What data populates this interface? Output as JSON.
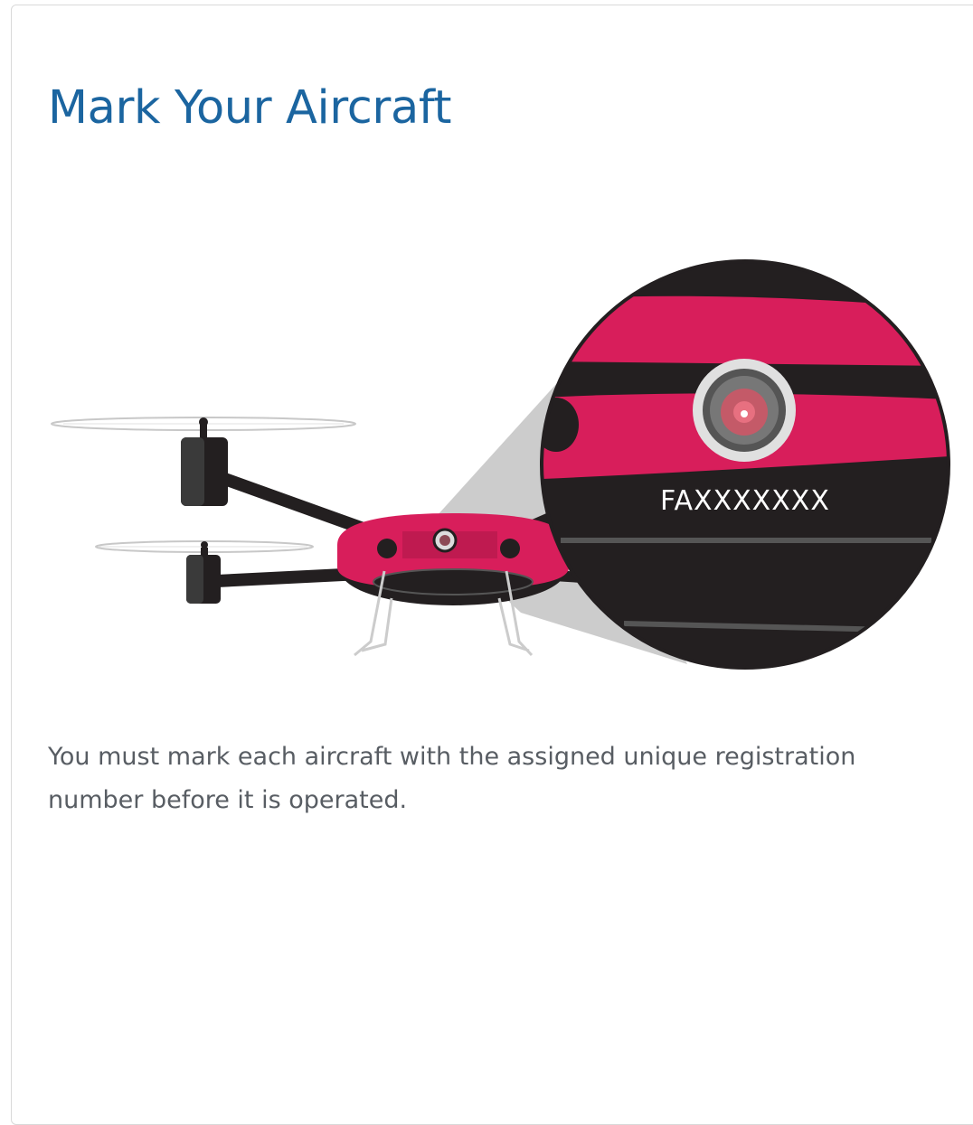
{
  "page": {
    "title": "Mark Your Aircraft",
    "description": "You must mark each aircraft with the assigned unique registration number before it is operated."
  },
  "illustration": {
    "registration_marking": "FAXXXXXXX",
    "colors": {
      "drone_body": "#d81e5b",
      "drone_dark": "#231f20",
      "title_blue": "#1b65a0",
      "zoom_cone": "#cccccc",
      "text_gray": "#585d63"
    }
  }
}
